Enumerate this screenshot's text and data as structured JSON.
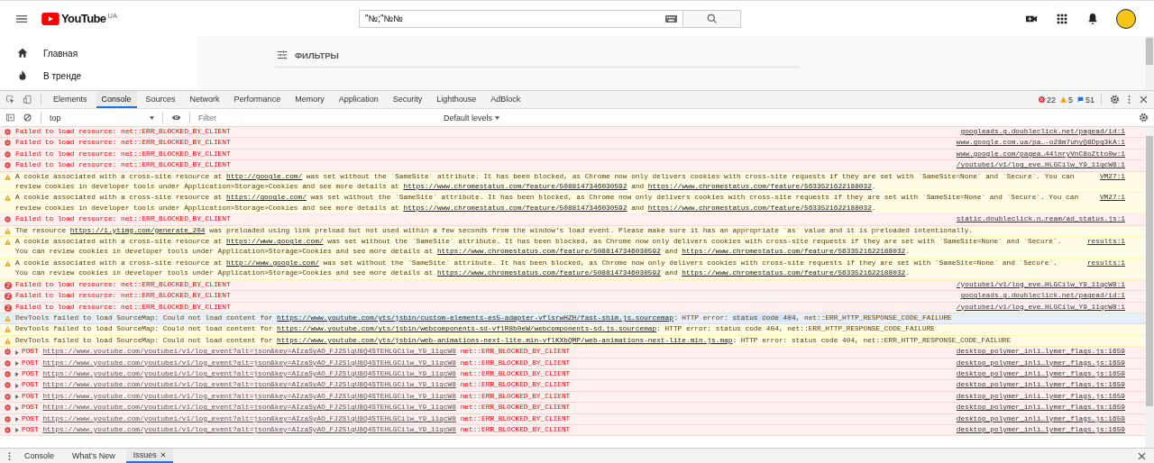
{
  "youtube": {
    "logo_text": "YouTube",
    "region": "UA",
    "search": {
      "value": "\"№;\"№№"
    },
    "sidebar": [
      {
        "kind": "home",
        "label": "Главная"
      },
      {
        "kind": "fire",
        "label": "В тренде"
      }
    ],
    "filters_label": "ФИЛЬТРЫ"
  },
  "devtools": {
    "tabs": [
      {
        "label": "Elements",
        "selected": false
      },
      {
        "label": "Console",
        "selected": true
      },
      {
        "label": "Sources",
        "selected": false
      },
      {
        "label": "Network",
        "selected": false
      },
      {
        "label": "Performance",
        "selected": false
      },
      {
        "label": "Memory",
        "selected": false
      },
      {
        "label": "Application",
        "selected": false
      },
      {
        "label": "Security",
        "selected": false
      },
      {
        "label": "Lighthouse",
        "selected": false
      },
      {
        "label": "AdBlock",
        "selected": false
      }
    ],
    "counts": {
      "errors": "22",
      "warnings": "5",
      "info": "51"
    },
    "context": "top",
    "filter": {
      "placeholder": "Filter"
    },
    "levels": "Default levels"
  },
  "messages": [
    {
      "kind": "error",
      "selected": false,
      "parts": [
        {
          "kind": "text",
          "text": "Failed to load resource: net::ERR_BLOCKED_BY_CLIENT"
        }
      ],
      "source": "googleads.g.doubleclick.net/pagead/id:1"
    },
    {
      "kind": "error",
      "selected": false,
      "parts": [
        {
          "kind": "text",
          "text": "Failed to load resource: net::ERR_BLOCKED_BY_CLIENT"
        }
      ],
      "source": "www.google.com.ua/pa…-o28m7uhyQ8Dpg3kA:1"
    },
    {
      "kind": "error",
      "selected": false,
      "parts": [
        {
          "kind": "text",
          "text": "Failed to load resource: net::ERR_BLOCKED_BY_CLIENT"
        }
      ],
      "source": "www.google.com/pagea…44lnryVnC8oZtto0w:1"
    },
    {
      "kind": "error",
      "selected": false,
      "parts": [
        {
          "kind": "text",
          "text": "Failed to load resource: net::ERR_BLOCKED_BY_CLIENT"
        }
      ],
      "source": "/youtubei/v1/log_eve…HLGCilw_Y9_11qcW8:1"
    },
    {
      "kind": "warning",
      "selected": false,
      "parts": [
        {
          "kind": "text",
          "text": "A cookie associated with a cross-site resource at "
        },
        {
          "kind": "link",
          "text": "http://google.com/"
        },
        {
          "kind": "text",
          "text": " was set without the `SameSite` attribute. It has been blocked, as Chrome now only delivers cookies with cross-site requests if they are set with `SameSite=None` and `Secure`. You can review cookies in developer tools under Application>Storage>Cookies and see more details at "
        },
        {
          "kind": "link",
          "text": "https://www.chromestatus.com/feature/5088147346030592"
        },
        {
          "kind": "text",
          "text": " and "
        },
        {
          "kind": "link",
          "text": "https://www.chromestatus.com/feature/5633521622188032"
        },
        {
          "kind": "text",
          "text": "."
        }
      ],
      "source": "VM27:1"
    },
    {
      "kind": "warning",
      "selected": false,
      "parts": [
        {
          "kind": "text",
          "text": "A cookie associated with a cross-site resource at "
        },
        {
          "kind": "link",
          "text": "https://google.com/"
        },
        {
          "kind": "text",
          "text": " was set without the `SameSite` attribute. It has been blocked, as Chrome now only delivers cookies with cross-site requests if they are set with `SameSite=None` and `Secure`. You can review cookies in developer tools under Application>Storage>Cookies and see more details at "
        },
        {
          "kind": "link",
          "text": "https://www.chromestatus.com/feature/5088147346030592"
        },
        {
          "kind": "text",
          "text": " and "
        },
        {
          "kind": "link",
          "text": "https://www.chromestatus.com/feature/5633521622188032"
        },
        {
          "kind": "text",
          "text": "."
        }
      ],
      "source": "VM27:1"
    },
    {
      "kind": "error",
      "selected": false,
      "parts": [
        {
          "kind": "text",
          "text": "Failed to load resource: net::ERR_BLOCKED_BY_CLIENT"
        }
      ],
      "source": "static.doubleclick.n…ream/ad_status.js:1"
    },
    {
      "kind": "warning",
      "selected": false,
      "parts": [
        {
          "kind": "text",
          "text": "The resource "
        },
        {
          "kind": "link",
          "text": "https://i.ytimg.com/generate_204"
        },
        {
          "kind": "text",
          "text": " was preloaded using link preload but not used within a few seconds from the window's load event. Please make sure it has an appropriate `as` value and it is preloaded intentionally."
        }
      ]
    },
    {
      "kind": "warning",
      "selected": false,
      "parts": [
        {
          "kind": "text",
          "text": "A cookie associated with a cross-site resource at "
        },
        {
          "kind": "link",
          "text": "https://www.google.com/"
        },
        {
          "kind": "text",
          "text": " was set without the `SameSite` attribute. It has been blocked, as Chrome now only delivers cookies with cross-site requests if they are set with `SameSite=None` and `Secure`. You can review cookies in developer tools under Application>Storage>Cookies and see more details at "
        },
        {
          "kind": "link",
          "text": "https://www.chromestatus.com/feature/5088147346030592"
        },
        {
          "kind": "text",
          "text": " and "
        },
        {
          "kind": "link",
          "text": "https://www.chromestatus.com/feature/5633521622188032"
        },
        {
          "kind": "text",
          "text": "."
        }
      ],
      "source": "results:1"
    },
    {
      "kind": "warning",
      "selected": false,
      "parts": [
        {
          "kind": "text",
          "text": "A cookie associated with a cross-site resource at "
        },
        {
          "kind": "link",
          "text": "http://www.google.com/"
        },
        {
          "kind": "text",
          "text": " was set without the `SameSite` attribute. It has been blocked, as Chrome now only delivers cookies with cross-site requests if they are set with `SameSite=None` and `Secure`. You can review cookies in developer tools under Application>Storage>Cookies and see more details at "
        },
        {
          "kind": "link",
          "text": "https://www.chromestatus.com/feature/5088147346030592"
        },
        {
          "kind": "text",
          "text": " and "
        },
        {
          "kind": "link",
          "text": "https://www.chromestatus.com/feature/5633521622188032"
        },
        {
          "kind": "text",
          "text": "."
        }
      ],
      "source": "results:1"
    },
    {
      "kind": "error",
      "count": "2",
      "selected": false,
      "parts": [
        {
          "kind": "text",
          "text": "Failed to load resource: net::ERR_BLOCKED_BY_CLIENT"
        }
      ],
      "source": "/youtubei/v1/log_eve…HLGCilw_Y9_11qcW8:1"
    },
    {
      "kind": "error",
      "count": "2",
      "selected": false,
      "parts": [
        {
          "kind": "text",
          "text": "Failed to load resource: net::ERR_BLOCKED_BY_CLIENT"
        }
      ],
      "source": "googleads.g.doubleclick.net/pagead/id:1"
    },
    {
      "kind": "error",
      "count": "2",
      "selected": false,
      "parts": [
        {
          "kind": "text",
          "text": "Failed to load resource: net::ERR_BLOCKED_BY_CLIENT"
        }
      ],
      "source": "/youtubei/v1/log_eve…HLGCilw_Y9_11qcW8:1"
    },
    {
      "kind": "warning",
      "selected": true,
      "parts": [
        {
          "kind": "text",
          "text": "DevTools failed to load SourceMap: Could not load content for "
        },
        {
          "kind": "link",
          "text": "https://www.youtube.com/yts/jsbin/custom-elements-es5-adapter-vflsrwHZH/fast-shim.js.sourcemap"
        },
        {
          "kind": "text",
          "text": ": HTTP error: "
        },
        {
          "kind": "highlight",
          "text": "status code 404"
        },
        {
          "kind": "text",
          "text": ", net::ERR_HTTP_RESPONSE_CODE_FAILURE"
        }
      ]
    },
    {
      "kind": "warning",
      "selected": false,
      "parts": [
        {
          "kind": "text",
          "text": "DevTools failed to load SourceMap: Could not load content for "
        },
        {
          "kind": "link",
          "text": "https://www.youtube.com/yts/jsbin/webcomponents-sd-vflR8b0eW/webcomponents-sd.js.sourcemap"
        },
        {
          "kind": "text",
          "text": ": HTTP error: status code 404, net::ERR_HTTP_RESPONSE_CODE_FAILURE"
        }
      ]
    },
    {
      "kind": "warning",
      "selected": false,
      "parts": [
        {
          "kind": "text",
          "text": "DevTools failed to load SourceMap: Could not load content for "
        },
        {
          "kind": "link",
          "text": "https://www.youtube.com/yts/jsbin/web-animations-next-lite.min-vflKXbQMP/web-animations-next-lite.min.js.map"
        },
        {
          "kind": "text",
          "text": ": HTTP error: status code 404, net::ERR_HTTP_RESPONSE_CODE_FAILURE"
        }
      ]
    },
    {
      "kind": "error",
      "expandable": true,
      "selected": false,
      "parts": [
        {
          "kind": "text",
          "text": "POST "
        },
        {
          "kind": "link",
          "text": "https://www.youtube.com/youtubei/v1/log_event?alt=json&key=AIzaSyAO_FJ2SlqU8Q4STEHLGCilw_Y9_11qcW8"
        },
        {
          "kind": "text",
          "text": " net::ERR_BLOCKED_BY_CLIENT"
        }
      ],
      "source": "desktop_polymer_inli…lymer_flags.js:1659"
    },
    {
      "kind": "error",
      "expandable": true,
      "selected": false,
      "parts": [
        {
          "kind": "text",
          "text": "POST "
        },
        {
          "kind": "link",
          "text": "https://www.youtube.com/youtubei/v1/log_event?alt=json&key=AIzaSyAO_FJ2SlqU8Q4STEHLGCilw_Y9_11qcW8"
        },
        {
          "kind": "text",
          "text": " net::ERR_BLOCKED_BY_CLIENT"
        }
      ],
      "source": "desktop_polymer_inli…lymer_flags.js:1659"
    },
    {
      "kind": "error",
      "expandable": true,
      "selected": false,
      "parts": [
        {
          "kind": "text",
          "text": "POST "
        },
        {
          "kind": "link",
          "text": "https://www.youtube.com/youtubei/v1/log_event?alt=json&key=AIzaSyAO_FJ2SlqU8Q4STEHLGCilw_Y9_11qcW8"
        },
        {
          "kind": "text",
          "text": " net::ERR_BLOCKED_BY_CLIENT"
        }
      ],
      "source": "desktop_polymer_inli…lymer_flags.js:1659"
    },
    {
      "kind": "error",
      "expandable": true,
      "selected": false,
      "parts": [
        {
          "kind": "text",
          "text": "POST "
        },
        {
          "kind": "link",
          "text": "https://www.youtube.com/youtubei/v1/log_event?alt=json&key=AIzaSyAO_FJ2SlqU8Q4STEHLGCilw_Y9_11qcW8"
        },
        {
          "kind": "text",
          "text": " net::ERR_BLOCKED_BY_CLIENT"
        }
      ],
      "source": "desktop_polymer_inli…lymer_flags.js:1659"
    },
    {
      "kind": "error",
      "expandable": true,
      "selected": false,
      "parts": [
        {
          "kind": "text",
          "text": "POST "
        },
        {
          "kind": "link",
          "text": "https://www.youtube.com/youtubei/v1/log_event?alt=json&key=AIzaSyAO_FJ2SlqU8Q4STEHLGCilw_Y9_11qcW8"
        },
        {
          "kind": "text",
          "text": " net::ERR_BLOCKED_BY_CLIENT"
        }
      ],
      "source": "desktop_polymer_inli…lymer_flags.js:1659"
    },
    {
      "kind": "error",
      "expandable": true,
      "selected": false,
      "parts": [
        {
          "kind": "text",
          "text": "POST "
        },
        {
          "kind": "link",
          "text": "https://www.youtube.com/youtubei/v1/log_event?alt=json&key=AIzaSyAO_FJ2SlqU8Q4STEHLGCilw_Y9_11qcW8"
        },
        {
          "kind": "text",
          "text": " net::ERR_BLOCKED_BY_CLIENT"
        }
      ],
      "source": "desktop_polymer_inli…lymer_flags.js:1659"
    },
    {
      "kind": "error",
      "expandable": true,
      "selected": false,
      "parts": [
        {
          "kind": "text",
          "text": "POST "
        },
        {
          "kind": "link",
          "text": "https://www.youtube.com/youtubei/v1/log_event?alt=json&key=AIzaSyAO_FJ2SlqU8Q4STEHLGCilw_Y9_11qcW8"
        },
        {
          "kind": "text",
          "text": " net::ERR_BLOCKED_BY_CLIENT"
        }
      ],
      "source": "desktop_polymer_inli…lymer_flags.js:1659"
    },
    {
      "kind": "error",
      "expandable": true,
      "selected": false,
      "parts": [
        {
          "kind": "text",
          "text": "POST "
        },
        {
          "kind": "link",
          "text": "https://www.youtube.com/youtubei/v1/log_event?alt=json&key=AIzaSyAO_FJ2SlqU8Q4STEHLGCilw_Y9_11qcW8"
        },
        {
          "kind": "text",
          "text": " net::ERR_BLOCKED_BY_CLIENT"
        }
      ],
      "source": "desktop_polymer_inli…lymer_flags.js:1659"
    }
  ],
  "drawer": {
    "tabs": [
      {
        "label": "Console",
        "selected": false,
        "closable": false
      },
      {
        "label": "What's New",
        "selected": false,
        "closable": false
      },
      {
        "label": "Issues",
        "selected": true,
        "closable": true
      }
    ]
  }
}
